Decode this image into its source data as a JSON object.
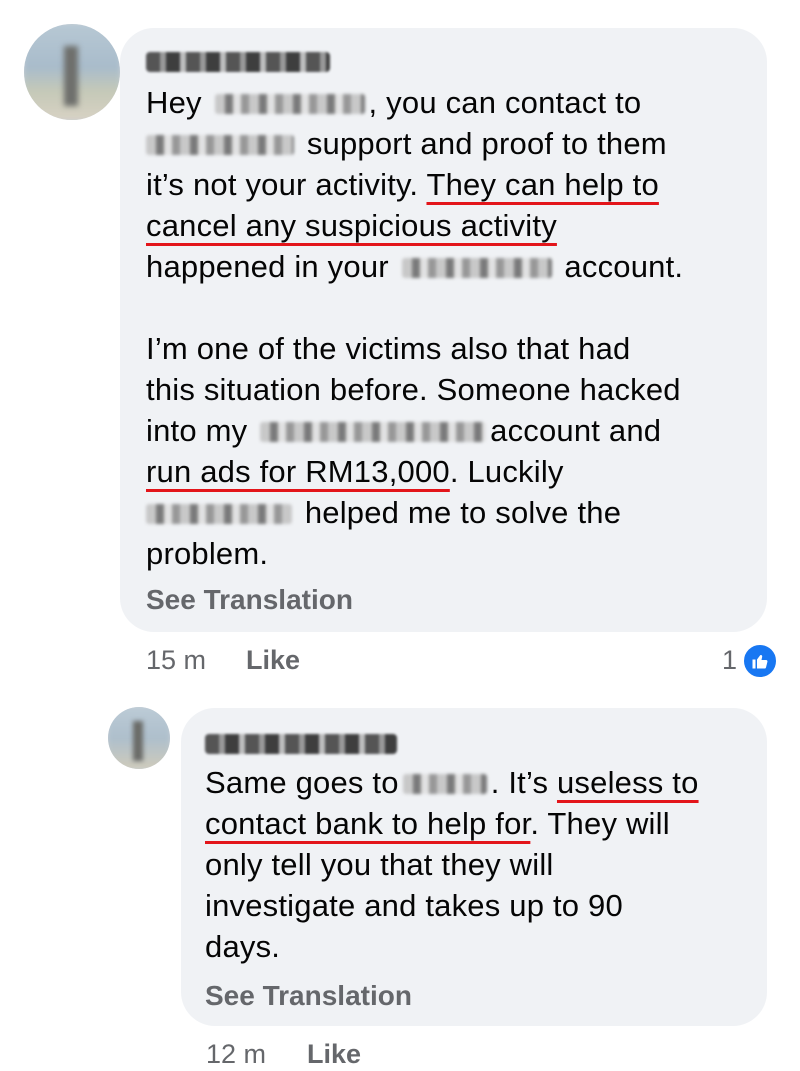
{
  "comment1": {
    "lines": [
      [
        "Hey ",
        "",
        ", you can contact to"
      ],
      [
        "",
        " support and proof to them"
      ],
      [
        "it’s not your activity. ",
        "They can help to"
      ],
      [
        "cancel any suspicious activity"
      ],
      [
        "happened in your ",
        "",
        " account."
      ],
      [],
      [
        "I’m one of the victims also that had"
      ],
      [
        "this situation before. Someone hacked"
      ],
      [
        "into my ",
        "",
        "account and"
      ],
      [
        "run ads for RM13,000",
        ". Luckily"
      ],
      [
        "",
        " helped me to solve the"
      ],
      [
        "problem."
      ]
    ],
    "see_translation": "See Translation",
    "time": "15 m",
    "like_label": "Like",
    "reaction_count": "1"
  },
  "comment2": {
    "lines": [
      [
        "Same goes to",
        "",
        ". It’s ",
        "useless to"
      ],
      [
        "contact bank to help for",
        ". They will"
      ],
      [
        "only tell you that they will"
      ],
      [
        "investigate and takes up to 90"
      ],
      [
        "days."
      ]
    ],
    "see_translation": "See Translation",
    "time": "12 m",
    "like_label": "Like"
  },
  "colors": {
    "bubble": "#f0f2f5",
    "underline": "#e3151a",
    "meta": "#65676b",
    "like_blue": "#1877f2"
  },
  "icons": [
    "thumbs-up-icon"
  ]
}
